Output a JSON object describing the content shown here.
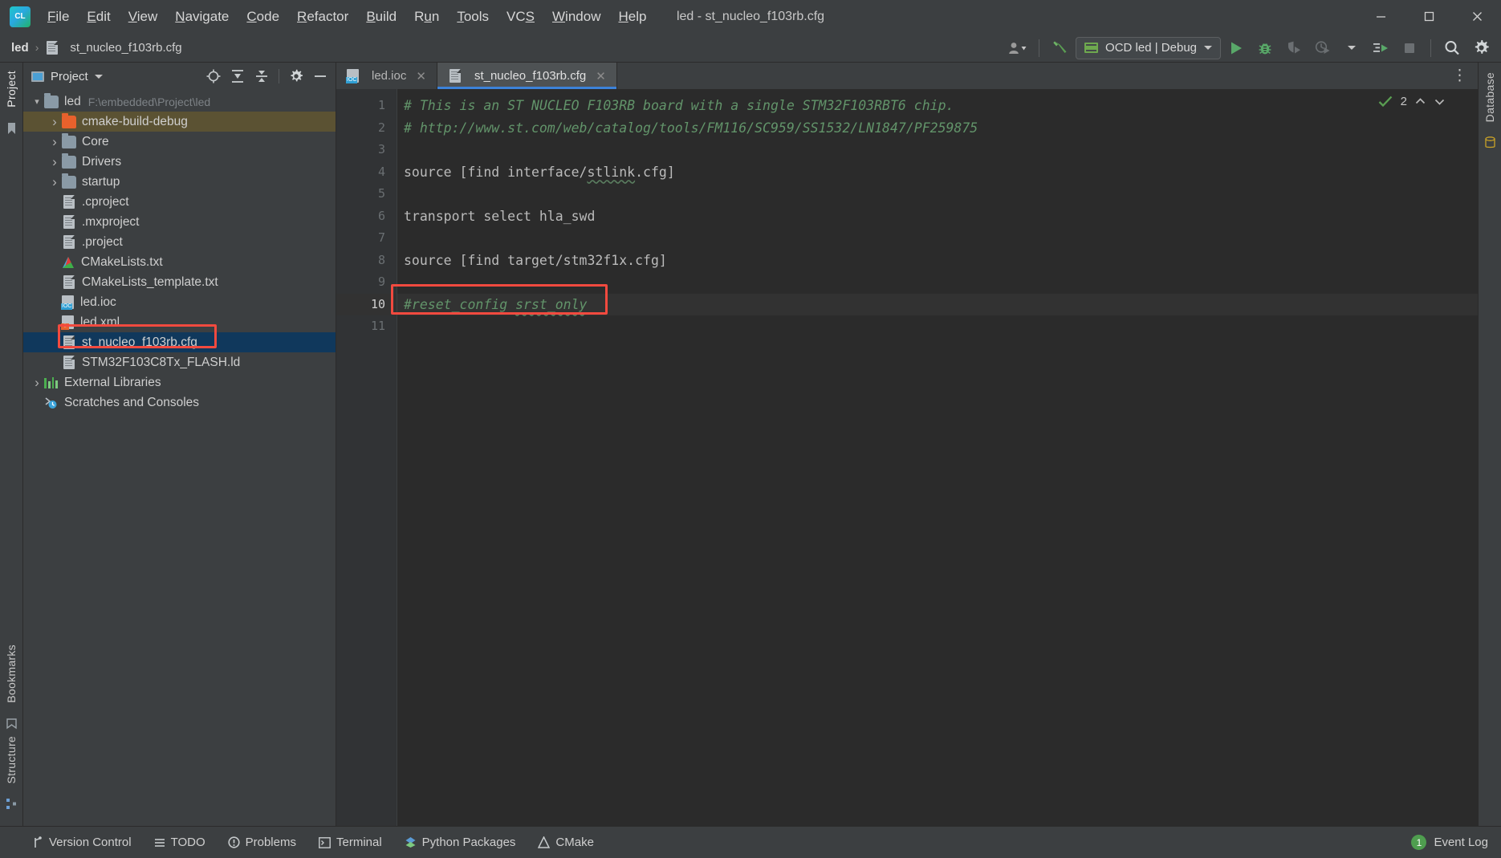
{
  "window": {
    "app_logo_text": "CL",
    "title": "led - st_nucleo_f103rb.cfg",
    "minimize": "—",
    "maximize": "☐",
    "close": "✕"
  },
  "menubar": {
    "items": [
      {
        "label": "File",
        "mnemonic": "F"
      },
      {
        "label": "Edit",
        "mnemonic": "E"
      },
      {
        "label": "View",
        "mnemonic": "V"
      },
      {
        "label": "Navigate",
        "mnemonic": "N"
      },
      {
        "label": "Code",
        "mnemonic": "C"
      },
      {
        "label": "Refactor",
        "mnemonic": "R"
      },
      {
        "label": "Build",
        "mnemonic": "B"
      },
      {
        "label": "Run",
        "mnemonic": "u"
      },
      {
        "label": "Tools",
        "mnemonic": "T"
      },
      {
        "label": "VCS",
        "mnemonic": "S"
      },
      {
        "label": "Window",
        "mnemonic": "W"
      },
      {
        "label": "Help",
        "mnemonic": "H"
      }
    ]
  },
  "navbar": {
    "breadcrumb": [
      {
        "label": "led",
        "icon": "project-icon"
      },
      {
        "label": "st_nucleo_f103rb.cfg",
        "icon": "file-icon"
      }
    ],
    "separator": "›",
    "run_config": {
      "label": "OCD led | Debug",
      "icon": "mcu-chip-icon",
      "dropdown": "▼"
    },
    "buttons": [
      {
        "name": "user-account-button",
        "icon": "person-icon"
      },
      {
        "name": "build-hammer-button",
        "icon": "hammer-icon"
      },
      {
        "name": "run-button",
        "icon": "play-icon"
      },
      {
        "name": "debug-button",
        "icon": "bug-icon"
      },
      {
        "name": "run-with-coverage-button",
        "icon": "shield-run-icon"
      },
      {
        "name": "profile-button",
        "icon": "clock-run-icon"
      },
      {
        "name": "profile-dropdown-button",
        "icon": "chevron-down-icon"
      },
      {
        "name": "attach-to-process-button",
        "icon": "attach-icon"
      },
      {
        "name": "stop-button",
        "icon": "stop-square-icon"
      },
      {
        "name": "search-everywhere-button",
        "icon": "search-icon"
      },
      {
        "name": "settings-button",
        "icon": "gear-icon"
      }
    ]
  },
  "left_stripe": {
    "top_label": "Project",
    "labels": [
      "Structure",
      "Bookmarks"
    ]
  },
  "right_stripe": {
    "label": "Database"
  },
  "project_panel": {
    "title": "Project",
    "dropdown": "▾",
    "toolbar": [
      {
        "name": "select-opened-file-button",
        "icon": "crosshair-icon"
      },
      {
        "name": "expand-all-button",
        "icon": "expand-all-icon"
      },
      {
        "name": "collapse-all-button",
        "icon": "collapse-all-icon"
      },
      {
        "name": "panel-settings-button",
        "icon": "gear-icon"
      },
      {
        "name": "hide-panel-button",
        "icon": "minus-icon"
      }
    ],
    "tree": [
      {
        "label": "led",
        "path": "F:\\embedded\\Project\\led",
        "icon": "folder-icon",
        "indent": 0,
        "arrow": "⌄",
        "expanded": true,
        "selected": "none"
      },
      {
        "label": "cmake-build-debug",
        "icon": "folder-orange-icon",
        "indent": 1,
        "arrow": "›",
        "selected": "olive"
      },
      {
        "label": "Core",
        "icon": "folder-icon",
        "indent": 1,
        "arrow": "›",
        "selected": "none"
      },
      {
        "label": "Drivers",
        "icon": "folder-icon",
        "indent": 1,
        "arrow": "›",
        "selected": "none"
      },
      {
        "label": "startup",
        "icon": "folder-icon",
        "indent": 1,
        "arrow": "›",
        "selected": "none"
      },
      {
        "label": ".cproject",
        "icon": "file-icon",
        "indent": 1,
        "arrow": "",
        "selected": "none"
      },
      {
        "label": ".mxproject",
        "icon": "file-icon",
        "indent": 1,
        "arrow": "",
        "selected": "none"
      },
      {
        "label": ".project",
        "icon": "file-icon",
        "indent": 1,
        "arrow": "",
        "selected": "none"
      },
      {
        "label": "CMakeLists.txt",
        "icon": "cmake-icon",
        "indent": 1,
        "arrow": "",
        "selected": "none"
      },
      {
        "label": "CMakeLists_template.txt",
        "icon": "file-icon",
        "indent": 1,
        "arrow": "",
        "selected": "none"
      },
      {
        "label": "led.ioc",
        "icon": "ioc-file-icon",
        "indent": 1,
        "arrow": "",
        "selected": "none"
      },
      {
        "label": "led.xml",
        "icon": "xml-file-icon",
        "indent": 1,
        "arrow": "",
        "selected": "none"
      },
      {
        "label": "st_nucleo_f103rb.cfg",
        "icon": "file-icon",
        "indent": 1,
        "arrow": "",
        "selected": "blue",
        "annotated": true
      },
      {
        "label": "STM32F103C8Tx_FLASH.ld",
        "icon": "file-icon",
        "indent": 1,
        "arrow": "",
        "selected": "none"
      },
      {
        "label": "External Libraries",
        "icon": "library-icon",
        "indent": 0,
        "arrow": "›",
        "selected": "none"
      },
      {
        "label": "Scratches and Consoles",
        "icon": "scratches-icon",
        "indent": 0,
        "arrow": "",
        "selected": "none"
      }
    ]
  },
  "editor": {
    "tabs": [
      {
        "label": "led.ioc",
        "icon": "ioc-file-icon",
        "active": false,
        "close": "✕"
      },
      {
        "label": "st_nucleo_f103rb.cfg",
        "icon": "file-icon",
        "active": true,
        "close": "✕"
      }
    ],
    "tab_options_icon": "more-options-icon",
    "inspection": {
      "count": "2",
      "status_icon": "inspection-ok-icon",
      "up_icon": "⌃",
      "down_icon": "⌄"
    },
    "current_line": 10,
    "lines": [
      {
        "n": 1,
        "text": "# This is an ST NUCLEO F103RB board with a single STM32F103RBT6 chip.",
        "style": "comment"
      },
      {
        "n": 2,
        "text": "# http://www.st.com/web/catalog/tools/FM116/SC959/SS1532/LN1847/PF259875",
        "style": "comment"
      },
      {
        "n": 3,
        "text": "",
        "style": "plain"
      },
      {
        "n": 4,
        "text": "source [find interface/stlink.cfg]",
        "style": "code",
        "spell_word": "stlink"
      },
      {
        "n": 5,
        "text": "",
        "style": "plain"
      },
      {
        "n": 6,
        "text": "transport select hla_swd",
        "style": "code"
      },
      {
        "n": 7,
        "text": "",
        "style": "plain"
      },
      {
        "n": 8,
        "text": "source [find target/stm32f1x.cfg]",
        "style": "code"
      },
      {
        "n": 9,
        "text": "",
        "style": "plain"
      },
      {
        "n": 10,
        "text": "#reset_config srst_only",
        "style": "comment",
        "spell_word": "srst_only",
        "annotated": true
      },
      {
        "n": 11,
        "text": "",
        "style": "plain"
      }
    ]
  },
  "statusbar": {
    "items": [
      {
        "label": "Version Control",
        "icon": "branch-icon"
      },
      {
        "label": "TODO",
        "icon": "list-icon"
      },
      {
        "label": "Problems",
        "icon": "warning-circle-icon"
      },
      {
        "label": "Terminal",
        "icon": "terminal-icon"
      },
      {
        "label": "Python Packages",
        "icon": "python-icon"
      },
      {
        "label": "CMake",
        "icon": "cmake-triangle-icon"
      }
    ],
    "event_log": {
      "label": "Event Log",
      "badge": "1"
    }
  },
  "colors": {
    "accent_blue": "#3c82d9",
    "annotation_red": "#f24a3f",
    "selection_blue": "#10385c",
    "selection_olive": "#5b5233",
    "comment_green": "#62946a",
    "bg_panel": "#3c3f41",
    "bg_editor": "#2b2b2b"
  }
}
